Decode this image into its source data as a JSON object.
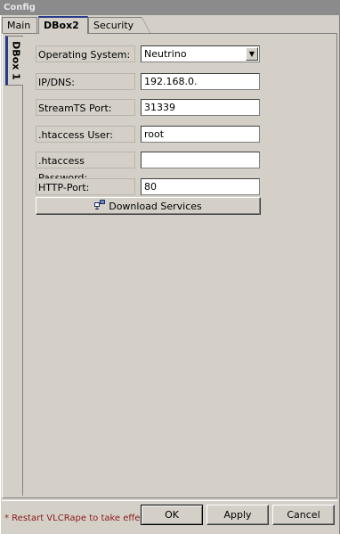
{
  "window": {
    "title": "Config"
  },
  "tabs": [
    {
      "label": "Main"
    },
    {
      "label": "DBox2",
      "active": true
    },
    {
      "label": "Security"
    }
  ],
  "side_tabs": [
    {
      "label": "DBox 1",
      "active": true
    }
  ],
  "form": {
    "os_label": "Operating System:",
    "os_value": "Neutrino",
    "ip_label": "IP/DNS:",
    "ip_value": "192.168.0.",
    "stream_label": "StreamTS Port:",
    "stream_value": "31339",
    "user_label": ".htaccess User:",
    "user_value": "root",
    "pass_label": ".htaccess Password:",
    "pass_value": "",
    "http_label": "HTTP-Port:",
    "http_value": "80",
    "download_label": "Download Services"
  },
  "footer": {
    "status": "* Restart VLCRape to take effect!",
    "ok": "OK",
    "apply": "Apply",
    "cancel": "Cancel"
  },
  "icons": {
    "download": "network-download-icon",
    "dropdown": "chevron-down-icon"
  },
  "colors": {
    "status_text": "#8b1a1a",
    "active_tab_accent": "#2a3a8a",
    "title_bar": "#8b8b8b"
  }
}
